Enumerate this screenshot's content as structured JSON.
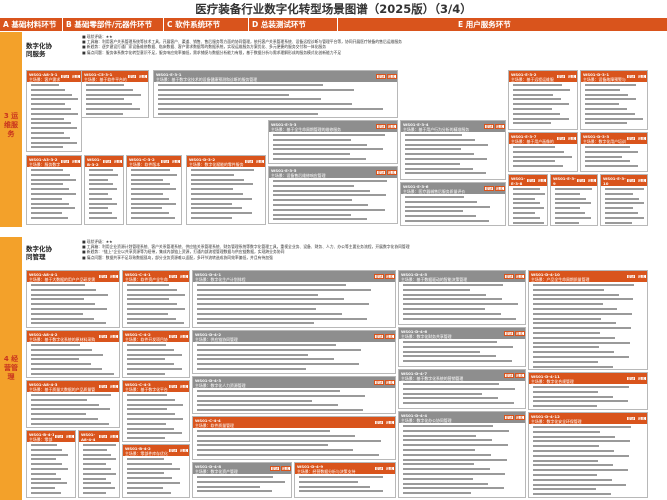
{
  "title": "医疗装备行业数字化转型场景图谱（2025版）（3/4）",
  "tabs": [
    {
      "label": "A 基础材料环节"
    },
    {
      "label": "B 基础零部件/元器件环节"
    },
    {
      "label": "C 软件系统环节"
    },
    {
      "label": "D 总装测试环节"
    },
    {
      "label": "E 用户服务环节"
    }
  ],
  "sections": [
    {
      "side": "3 运维服务",
      "title": "数字化协同服务",
      "desc": [
        "■ 现状评级：★★",
        "■ 工具箱：利用客户关系管理系统等技术工具，开展客户、渠道、销售、售后服务等方面的协同管理，依托客户关系管理系统、设备远程诊断与管理平台等，协同开展医疗装备的售后运维服务",
        "■ 新趋势：逐步建设打通厂家设备维修数据、临床数据、客户需求数据等的数据系统，实现运维服务方案优化、多元便捷的服务交付和一体化服务",
        "■ 痛点问题：服务体系数字化转型意识不足，服务响应效率偏低，需求捕捉与数据分析能力有限，基于数据分析与需求理解形成的服务模式化创新能力不足"
      ]
    },
    {
      "side": "4 经营管理",
      "title": "数字化协同管理",
      "desc": [
        "■ 现状评级：★★",
        "■ 工具箱：利用企业资源计划管理系统、客户关系管理系统、供应链关系管理系统、财务管理系统等数字化管理工具，重视全业务、设备、财务、人力、办公等主要业务流程，开展数字化协同管理",
        "■ 新趋势：“链上”企业以共享资源等为纽带，集成内部链上资源，打通内部流程管理数据与供应链数据，实现跨业务协同",
        "■ 痛点问题：数据共享不足导致数据孤岛，部分业务资源难以适配，多环节流转造成协同效率偏低，并且有待加强"
      ]
    }
  ],
  "card_labels": {
    "a": "现状",
    "b": "降本"
  },
  "cards": [
    {
      "id": "WS01-A8-3-1",
      "title": "主场景：客户需求驱动产品研发与服务管理"
    },
    {
      "id": "WS01-C5-3-1",
      "title": "主场景：基于软件平台的设备远程运维管理"
    },
    {
      "id": "WS01-E-3-1",
      "title": "主场景：基于数字化技术的设备健康预测和诊断的服务管理"
    },
    {
      "id": "WS01-E-3-2",
      "title": "主场景：基于远程运维服务平台的维护"
    },
    {
      "id": "WS01-D-3-1",
      "title": "主场景：设备故障预警与诊断服务"
    },
    {
      "id": "WS01-E-3-3",
      "title": "主场景：基于全生命周期管理的维修服务"
    },
    {
      "id": "WS01-E-3-4",
      "title": "主场景：基于用户行为分析的精准服务"
    },
    {
      "id": "WS01-A3-3-2",
      "title": "主场景：服务数字化管理"
    },
    {
      "id": "WS01-B-3-2",
      "title": "主场景：零部件质量追溯管理"
    },
    {
      "id": "WS01-C-3-2",
      "title": "主场景：软件版本升级服务"
    },
    {
      "id": "WS01-D-3-2",
      "title": "主场景：数字化赋能的零件服务"
    },
    {
      "id": "WS01-E-3-5",
      "title": "主场景：设备售后维修响应管理"
    },
    {
      "id": "WS01-E-3-6",
      "title": "主场景：医疗器械售后服务质量评价"
    },
    {
      "id": "WS01-E-3-7",
      "title": "主场景：基于用户画像的智能推荐"
    },
    {
      "id": "WS01-D-3-3",
      "title": "主场景：数字化用户培训与赋能"
    },
    {
      "id": "WS01-E-3-8",
      "title": "主场景：数字化运维服务质量管理"
    },
    {
      "id": "WS01-E-3-9",
      "title": "主场景：备件智能化管理"
    },
    {
      "id": "WS01-E-3-10",
      "title": "主场景：远程诊断服务"
    },
    {
      "id": "WS01-A8-4-1",
      "title": "主场景：基于大数据的用户产品研发需求管理"
    },
    {
      "id": "WS01-C-4-1",
      "title": "主场景：软件资产全生命周期管理"
    },
    {
      "id": "WS01-D-4-1",
      "title": "主场景：数字化生产计划排程"
    },
    {
      "id": "WS01-D-4-5",
      "title": "主场景：基于数据驱动的智能决策管理"
    },
    {
      "id": "WS01-D-4-10",
      "title": "主场景：产品全生命周期质量管理"
    },
    {
      "id": "WS01-A8-4-2",
      "title": "主场景：基于数字化系统的原材料采购管理"
    },
    {
      "id": "WS01-C-4-2",
      "title": "主场景：软件开发项目协同管理"
    },
    {
      "id": "WS01-D-4-2",
      "title": "主场景：供应链协同管理"
    },
    {
      "id": "WS01-D-4-6",
      "title": "主场景：数字化财务共享管理"
    },
    {
      "id": "WS01-D-4-11",
      "title": "主场景：数字化合规管理"
    },
    {
      "id": "WS01-A8-4-3",
      "title": "主场景：基于质量大数据的产品质量管理"
    },
    {
      "id": "WS01-B-4-1",
      "title": "主场景：零部件供应商管理"
    },
    {
      "id": "WS01-C-4-3",
      "title": "主场景：基于数字化平台的知识管理"
    },
    {
      "id": "WS01-D-4-3",
      "title": "主场景：数字化人力资源管理"
    },
    {
      "id": "WS01-D-4-7",
      "title": "主场景：基于数字化系统的营销管理"
    },
    {
      "id": "WS01-D-4-12",
      "title": "主场景：数字化安全环保管理"
    },
    {
      "id": "WS01-A8-4-4",
      "title": "主场景：原材料库存管理"
    },
    {
      "id": "WS01-B-4-2",
      "title": "主场景：零部件库存优化管理"
    },
    {
      "id": "WS01-C-4-4",
      "title": "主场景：软件质量管理"
    },
    {
      "id": "WS01-D-4-4",
      "title": "主场景：数字化办公协同管理"
    },
    {
      "id": "WS01-D-4-8",
      "title": "主场景：数字化资产管理"
    },
    {
      "id": "WS01-D-4-9",
      "title": "主场景：经营数据分析与决策支持"
    },
    {
      "id": "WS01-D-4-13",
      "title": "主场景：数字化风险管理"
    }
  ]
}
